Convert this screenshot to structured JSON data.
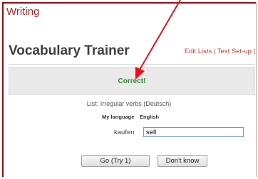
{
  "section_title": "Writing",
  "app_title": "Vocabulary Trainer",
  "top_links": {
    "edit_lists": "Edit Lists",
    "separator": "|",
    "test_setup": "Test Set-up",
    "trailing_separator": "|"
  },
  "feedback": {
    "message": "Correct!",
    "color": "#2f8a2f"
  },
  "list_name": "List: Irregular verbs (Deutsch)",
  "languages": {
    "my_language_label": "My language",
    "target_language": "English"
  },
  "question": {
    "word": "kaufen",
    "answer_value": "sell"
  },
  "buttons": {
    "go": "Go (Try 1)",
    "dont_know": "Don't know"
  },
  "colors": {
    "accent": "#b52424",
    "arrow": "#e8101a",
    "frame": "#8b0f12"
  }
}
